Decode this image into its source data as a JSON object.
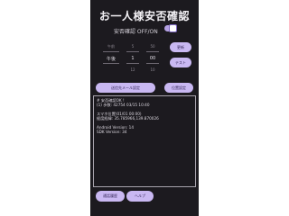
{
  "app": {
    "title": "お一人様安否確認",
    "safety_check_label": "安否確認 OFF/ON",
    "safety_check_on": true
  },
  "time_picker": {
    "period_options": [
      "午前",
      "午後"
    ],
    "hour_options": [
      "5",
      "1",
      "12"
    ],
    "minute_options": [
      "50",
      "00",
      "10"
    ],
    "selected_period": "午後",
    "selected_hour": "1",
    "selected_minute": "00"
  },
  "buttons": {
    "update": "更新",
    "test": "テスト",
    "message_settings": "送信先メール設定",
    "location_settings": "位置設定",
    "call_history": "通話履歴",
    "help": "ヘルプ"
  },
  "log": {
    "lines": [
      "# 安否確認OK !",
      "(1) 歩数: 42754  03/15 10:40",
      "",
      "スマホ位置(01/01 00:00)",
      "経度経緯: 35.785966,139.870026",
      "",
      "Android Version: 14",
      "SDK Version: 34"
    ]
  },
  "colors": {
    "background": "#1c1a1f",
    "accent": "#c9b8f2",
    "accent_text": "#2d1f52",
    "text": "#f2f0f4"
  }
}
